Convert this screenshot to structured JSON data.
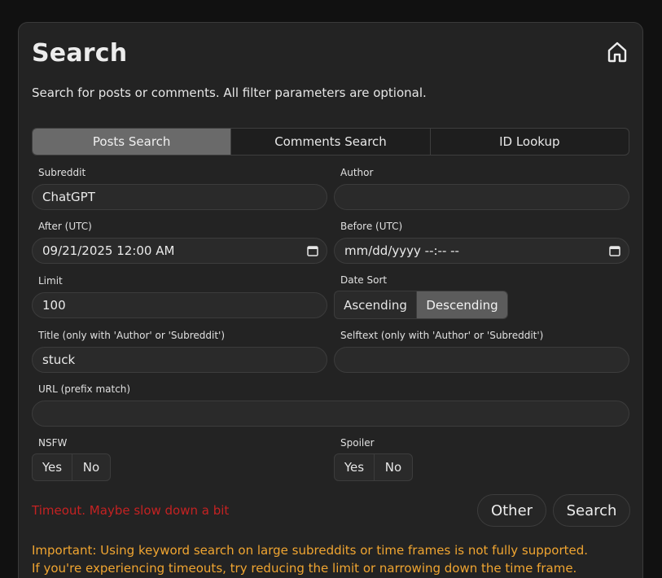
{
  "header": {
    "title": "Search",
    "subtitle": "Search for posts or comments. All filter parameters are optional."
  },
  "tabs": [
    {
      "label": "Posts Search",
      "active": true
    },
    {
      "label": "Comments Search",
      "active": false
    },
    {
      "label": "ID Lookup",
      "active": false
    }
  ],
  "fields": {
    "subreddit": {
      "label": "Subreddit",
      "value": "ChatGPT"
    },
    "author": {
      "label": "Author",
      "value": ""
    },
    "after": {
      "label": "After (UTC)",
      "value": "09/21/2025 12:00 AM"
    },
    "before": {
      "label": "Before (UTC)",
      "value": "mm/dd/yyyy --:-- --"
    },
    "limit": {
      "label": "Limit",
      "value": "100"
    },
    "title": {
      "label": "Title (only with 'Author' or 'Subreddit')",
      "value": "stuck"
    },
    "selftext": {
      "label": "Selftext (only with 'Author' or 'Subreddit')",
      "value": ""
    },
    "url": {
      "label": "URL (prefix match)",
      "value": ""
    }
  },
  "date_sort": {
    "label": "Date Sort",
    "options": [
      "Ascending",
      "Descending"
    ],
    "selected": "Descending"
  },
  "nsfw": {
    "label": "NSFW",
    "options": [
      "Yes",
      "No"
    ]
  },
  "spoiler": {
    "label": "Spoiler",
    "options": [
      "Yes",
      "No"
    ]
  },
  "status": {
    "error": "Timeout. Maybe slow down a bit"
  },
  "buttons": {
    "other": "Other",
    "search": "Search"
  },
  "notice": {
    "line1": "Important: Using keyword search on large subreddits or time frames is not fully supported.",
    "line2": "If you're experiencing timeouts, try reducing the limit or narrowing down the time frame."
  },
  "colors": {
    "background": "#111111",
    "card": "#232323",
    "active_tab": "#6a6a6a",
    "error": "#c42222",
    "notice": "#f0a531"
  },
  "icons": {
    "home": "home-icon",
    "calendar": "calendar-icon"
  }
}
